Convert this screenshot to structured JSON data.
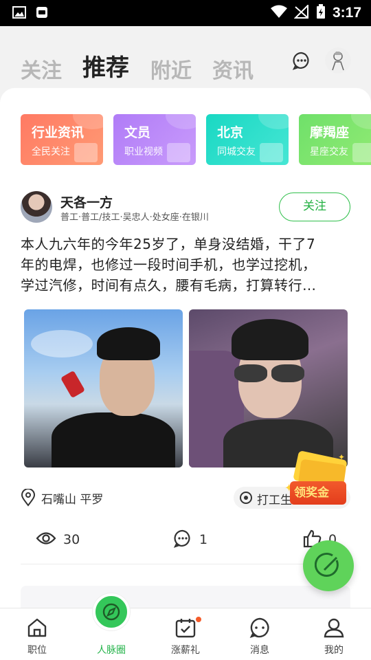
{
  "status_bar": {
    "time": "3:17"
  },
  "top_tabs": [
    {
      "label": "关注"
    },
    {
      "label": "推荐"
    },
    {
      "label": "附近"
    },
    {
      "label": "资讯"
    }
  ],
  "categories": [
    {
      "title": "行业资讯",
      "subtitle": "全民关注",
      "color_from": "#ff7a63",
      "color_to": "#ff9a74"
    },
    {
      "title": "文员",
      "subtitle": "职业视频",
      "color_from": "#b07cf7",
      "color_to": "#c99bfb"
    },
    {
      "title": "北京",
      "subtitle": "同城交友",
      "color_from": "#19d8c3",
      "color_to": "#46e6d4"
    },
    {
      "title": "摩羯座",
      "subtitle": "星座交友",
      "color_from": "#6fe06a",
      "color_to": "#93eb74"
    }
  ],
  "post": {
    "author": "天各一方",
    "meta": "普工·普工/技工·吴忠人·处女座·在银川",
    "follow_label": "关注",
    "text_lines": [
      "本人九六年的今年25岁了，单身没结婚，干了7",
      "年的电焊，也修过一段时间手机，也学过挖机，",
      "学过汽修，时间有点久，腰有毛病，打算转行…"
    ],
    "location": "石嘴山 平罗",
    "tag": "打工生",
    "reward_label": "领奖金",
    "views": "30",
    "comments": "1",
    "likes": "0"
  },
  "bottom_nav": [
    {
      "label": "职位",
      "active": false
    },
    {
      "label": "人脉圈",
      "active": true
    },
    {
      "label": "涨薪礼",
      "active": false
    },
    {
      "label": "消息",
      "active": false
    },
    {
      "label": "我的",
      "active": false
    }
  ],
  "colors": {
    "accent": "#2fbf4b",
    "reward": "#e84a22"
  }
}
